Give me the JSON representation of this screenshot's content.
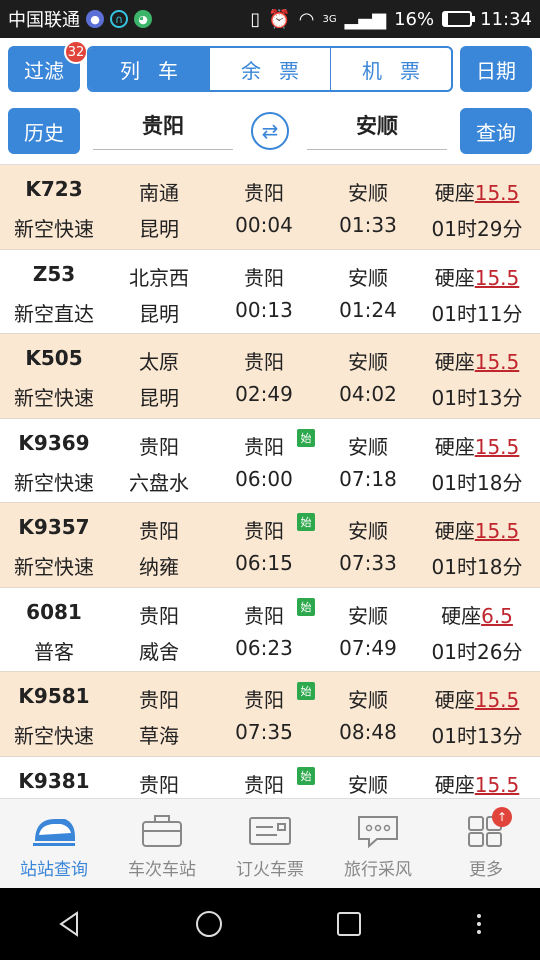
{
  "status": {
    "carrier": "中国联通",
    "battery": "16%",
    "time": "11:34",
    "network": "3G",
    "battery_level": 0.16
  },
  "toolbar": {
    "filter_label": "过滤",
    "filter_badge": "32",
    "segments": [
      "列车",
      "余票",
      "机票"
    ],
    "active_segment": "列车",
    "date_label": "日期",
    "history_label": "历史",
    "from_station": "贵阳",
    "to_station": "安顺",
    "query_label": "查询"
  },
  "trains": [
    {
      "no": "K723",
      "type": "新空快速",
      "origin": "南通",
      "dest": "昆明",
      "dep_station": "贵阳",
      "arr_station": "安顺",
      "dep": "00:04",
      "arr": "01:33",
      "seat": "硬座",
      "price": "15.5",
      "duration": "01时29分",
      "origin_start": false
    },
    {
      "no": "Z53",
      "type": "新空直达",
      "origin": "北京西",
      "dest": "昆明",
      "dep_station": "贵阳",
      "arr_station": "安顺",
      "dep": "00:13",
      "arr": "01:24",
      "seat": "硬座",
      "price": "15.5",
      "duration": "01时11分",
      "origin_start": false
    },
    {
      "no": "K505",
      "type": "新空快速",
      "origin": "太原",
      "dest": "昆明",
      "dep_station": "贵阳",
      "arr_station": "安顺",
      "dep": "02:49",
      "arr": "04:02",
      "seat": "硬座",
      "price": "15.5",
      "duration": "01时13分",
      "origin_start": false
    },
    {
      "no": "K9369",
      "type": "新空快速",
      "origin": "贵阳",
      "dest": "六盘水",
      "dep_station": "贵阳",
      "arr_station": "安顺",
      "dep": "06:00",
      "arr": "07:18",
      "seat": "硬座",
      "price": "15.5",
      "duration": "01时18分",
      "origin_start": true
    },
    {
      "no": "K9357",
      "type": "新空快速",
      "origin": "贵阳",
      "dest": "纳雍",
      "dep_station": "贵阳",
      "arr_station": "安顺",
      "dep": "06:15",
      "arr": "07:33",
      "seat": "硬座",
      "price": "15.5",
      "duration": "01时18分",
      "origin_start": true
    },
    {
      "no": "6081",
      "type": "普客",
      "origin": "贵阳",
      "dest": "威舍",
      "dep_station": "贵阳",
      "arr_station": "安顺",
      "dep": "06:23",
      "arr": "07:49",
      "seat": "硬座",
      "price": "6.5",
      "duration": "01时26分",
      "origin_start": true
    },
    {
      "no": "K9581",
      "type": "新空快速",
      "origin": "贵阳",
      "dest": "草海",
      "dep_station": "贵阳",
      "arr_station": "安顺",
      "dep": "07:35",
      "arr": "08:48",
      "seat": "硬座",
      "price": "15.5",
      "duration": "01时13分",
      "origin_start": true
    },
    {
      "no": "K9381",
      "type": "",
      "origin": "贵阳",
      "dest": "",
      "dep_station": "贵阳",
      "arr_station": "安顺",
      "dep": "",
      "arr": "",
      "seat": "硬座",
      "price": "15.5",
      "duration": "",
      "origin_start": true
    }
  ],
  "start_badge": "始",
  "tabs": [
    {
      "label": "站站查询",
      "icon": "train-icon",
      "active": true
    },
    {
      "label": "车次车站",
      "icon": "briefcase-icon",
      "active": false
    },
    {
      "label": "订火车票",
      "icon": "ticket-icon",
      "active": false
    },
    {
      "label": "旅行采风",
      "icon": "chat-icon",
      "active": false
    },
    {
      "label": "更多",
      "icon": "grid-icon",
      "active": false
    }
  ],
  "colors": {
    "accent": "#3a86d8",
    "row_alt": "#fbe8d3",
    "price": "#c0262e",
    "start_badge": "#2ea84c"
  }
}
